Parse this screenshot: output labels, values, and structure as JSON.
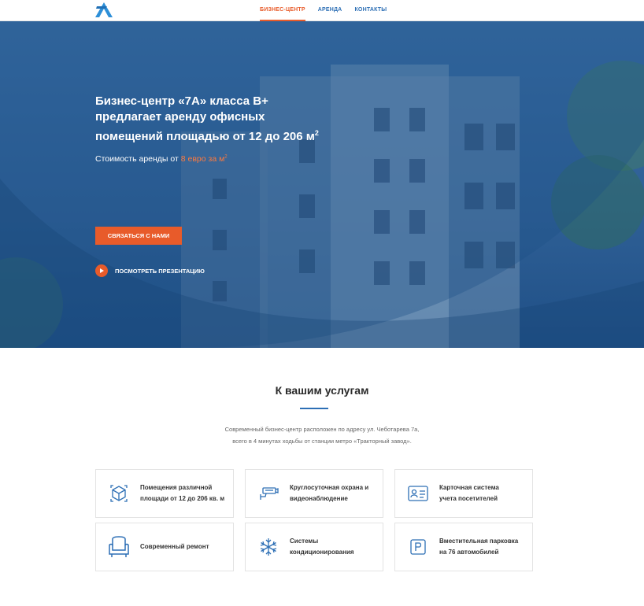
{
  "nav": {
    "logo_alt": "7A",
    "items": [
      {
        "label": "БИЗНЕС-ЦЕНТР",
        "active": true
      },
      {
        "label": "АРЕНДА",
        "active": false
      },
      {
        "label": "КОНТАКТЫ",
        "active": false
      }
    ]
  },
  "hero": {
    "title_line1": "Бизнес-центр «7А» класса В+",
    "title_line2": "предлагает аренду офисных",
    "title_line3": "помещений площадью от 12 до 206 м",
    "title_sup": "2",
    "price_prefix": "Стоимость аренды от ",
    "price_value": "8 евро за м",
    "price_sup": "2",
    "cta_label": "СВЯЗАТЬСЯ С НАМИ",
    "presentation_label": "ПОСМОТРЕТЬ ПРЕЗЕНТАЦИЮ"
  },
  "services": {
    "title": "К вашим услугам",
    "desc_line1": "Современный бизнес-центр расположен по адресу ул. Чеботарева 7а,",
    "desc_line2": "всего в 4 минутах ходьбы от станции метро «Тракторный завод».",
    "cards": [
      {
        "icon": "cube-icon",
        "line1": "Помещения различной",
        "line2": "площади от 12 до 206 кв. м"
      },
      {
        "icon": "cctv-camera-icon",
        "line1": "Круглосуточная охрана и",
        "line2": "видеонаблюдение"
      },
      {
        "icon": "id-card-icon",
        "line1": "Карточная система",
        "line2": "учета посетителей"
      },
      {
        "icon": "armchair-icon",
        "line1": "Современный ремонт",
        "line2": ""
      },
      {
        "icon": "snowflake-icon",
        "line1": "Системы",
        "line2": "кондиционирования"
      },
      {
        "icon": "parking-icon",
        "line1": "Вместительная парковка",
        "line2": "на 76 автомобилей"
      }
    ]
  },
  "colors": {
    "accent": "#e85b2a",
    "brand_blue": "#2d6fb5"
  }
}
